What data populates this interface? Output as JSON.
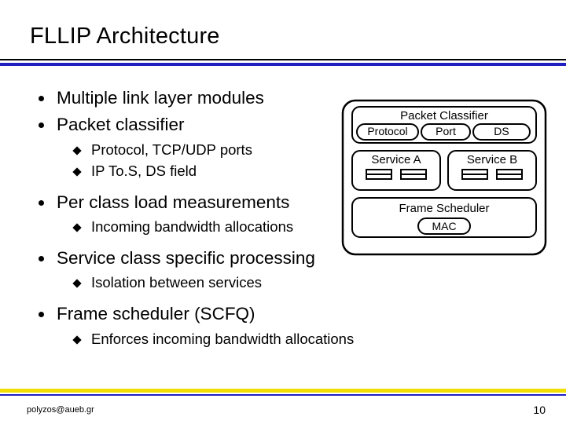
{
  "title": "FLLIP Architecture",
  "bullets": [
    {
      "text": "Multiple link layer modules",
      "sub": []
    },
    {
      "text": "Packet classifier",
      "sub": [
        "Protocol, TCP/UDP ports",
        "IP To.S, DS field"
      ]
    },
    {
      "text": "Per class load measurements",
      "sub": [
        "Incoming bandwidth allocations"
      ]
    },
    {
      "text": "Service class specific processing",
      "sub": [
        "Isolation between services"
      ]
    },
    {
      "text": "Frame scheduler (SCFQ)",
      "sub": [
        "Enforces incoming bandwidth allocations"
      ]
    }
  ],
  "diagram": {
    "outer_label": "",
    "packet_classifier": "Packet Classifier",
    "protocol": "Protocol",
    "port": "Port",
    "ds": "DS",
    "service_a": "Service A",
    "service_b": "Service B",
    "frame_scheduler": "Frame Scheduler",
    "mac": "MAC"
  },
  "footer": {
    "email": "polyzos@aueb.gr",
    "page": "10"
  }
}
